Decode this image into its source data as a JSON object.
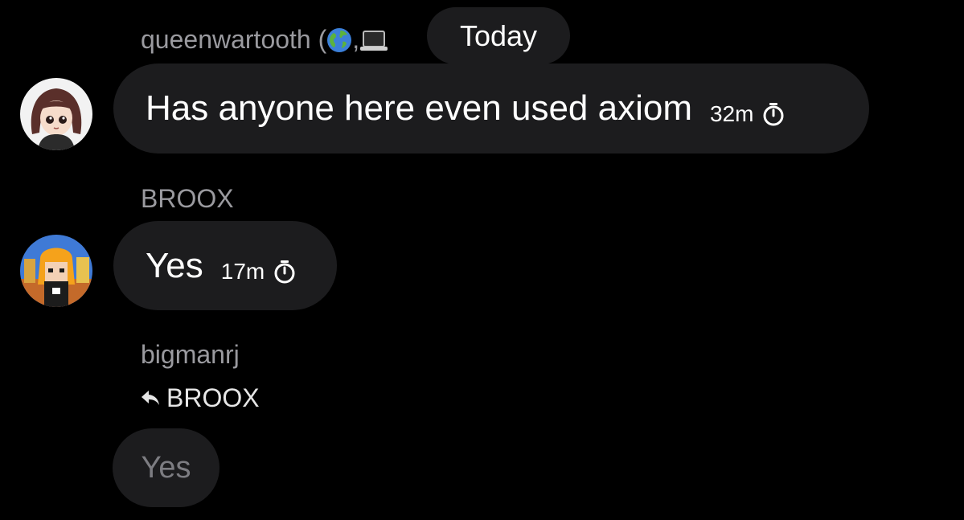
{
  "date_divider": "Today",
  "messages": [
    {
      "sender": "queenwartooth",
      "sender_suffix": "(",
      "sender_emojis": [
        "globe-icon",
        "laptop-icon"
      ],
      "text": "Has anyone here even used axiom",
      "time": "32m"
    },
    {
      "sender": "BROOX",
      "text": "Yes",
      "time": "17m"
    },
    {
      "sender": "bigmanrj",
      "reply_to": "BROOX",
      "text": "Yes"
    }
  ],
  "colors": {
    "background": "#000000",
    "bubble": "#1c1c1e",
    "sender_text": "#9a9a9f",
    "pending_text": "#7d7d82"
  }
}
